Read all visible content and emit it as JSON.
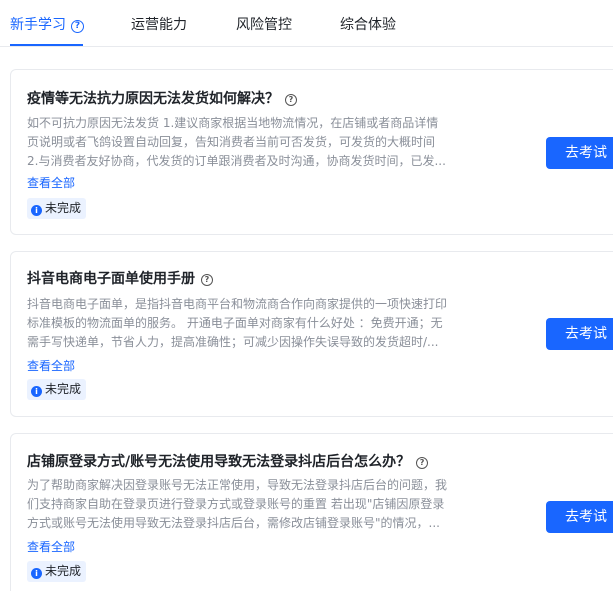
{
  "tabs": [
    {
      "label": "新手学习",
      "active": true
    },
    {
      "label": "运营能力",
      "active": false
    },
    {
      "label": "风险管控",
      "active": false
    },
    {
      "label": "综合体验",
      "active": false
    }
  ],
  "cards": [
    {
      "title": "疫情等无法抗力原因无法发货如何解决？",
      "desc": [
        "如不可抗力原因无法发货 1.建议商家根据当地物流情况，在店铺或者商品详情",
        "页说明或者飞鸽设置自动回复，告知消费者当前可否发货，可发货的大概时间",
        "2.与消费者友好协商，代发货的订单跟消费者及时沟通，协商发货时间，已发..."
      ],
      "view_all": "查看全部",
      "status": "未完成",
      "button": "去考试"
    },
    {
      "title": "抖音电商电子面单使用手册",
      "desc": [
        "抖音电商电子面单，是指抖音电商平台和物流商合作向商家提供的一项快速打印",
        "标准模板的物流面单的服务。 开通电子面单对商家有什么好处 ：免费开通；无",
        "需手写快递单，节省人力，提高准确性；可减少因操作失误导致的发货超时/..."
      ],
      "view_all": "查看全部",
      "status": "未完成",
      "button": "去考试"
    },
    {
      "title": "店铺原登录方式/账号无法使用导致无法登录抖店后台怎么办？",
      "desc": [
        "为了帮助商家解决因登录账号无法正常使用，导致无法登录抖店后台的问题，我",
        "们支持商家自助在登录页进行登录方式或登录账号的重置 若出现\"店铺因原登录",
        "方式或账号无法使用导致无法登录抖店后台，需修改店铺登录账号\"的情况，..."
      ],
      "view_all": "查看全部",
      "status": "未完成",
      "button": "去考试"
    }
  ]
}
